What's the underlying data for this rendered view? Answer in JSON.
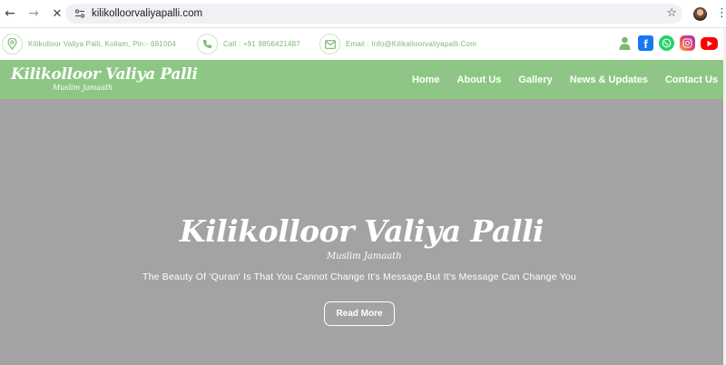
{
  "browser": {
    "url": "kilikolloorvaliyapalli.com",
    "back_icon": "arrow-left-icon",
    "forward_icon": "arrow-right-icon",
    "stop_icon": "close-icon",
    "bookmark_icon": "star-icon",
    "menu_icon": "kebab-menu-icon"
  },
  "topbar": {
    "address": "Kilikolloor Valiya Palli, Kollam, Pin:- 691004",
    "phone": "Call : +91 9856421487",
    "email": "Email : Info@Kilikalloorvaliyapalli.Com",
    "accent_color": "#7aba6f",
    "social_icons": [
      "user-icon",
      "facebook-icon",
      "whatsapp-icon",
      "instagram-icon",
      "youtube-icon"
    ]
  },
  "header": {
    "logo_name": "Kilikolloor Valiya Palli",
    "logo_sub": "Muslim Jamaath",
    "background_color": "#8ec785",
    "menu": [
      "Home",
      "About Us",
      "Gallery",
      "News & Updates",
      "Contact Us"
    ]
  },
  "hero": {
    "title": "Kilikolloor Valiya Palli",
    "subtitle": "Muslim Jamaath",
    "tagline": "The Beauty Of 'Quran' Is That You Cannot Change It's Message,But It's Message Can Change You",
    "button_label": "Read More",
    "background_color": "#a3a3a3"
  }
}
